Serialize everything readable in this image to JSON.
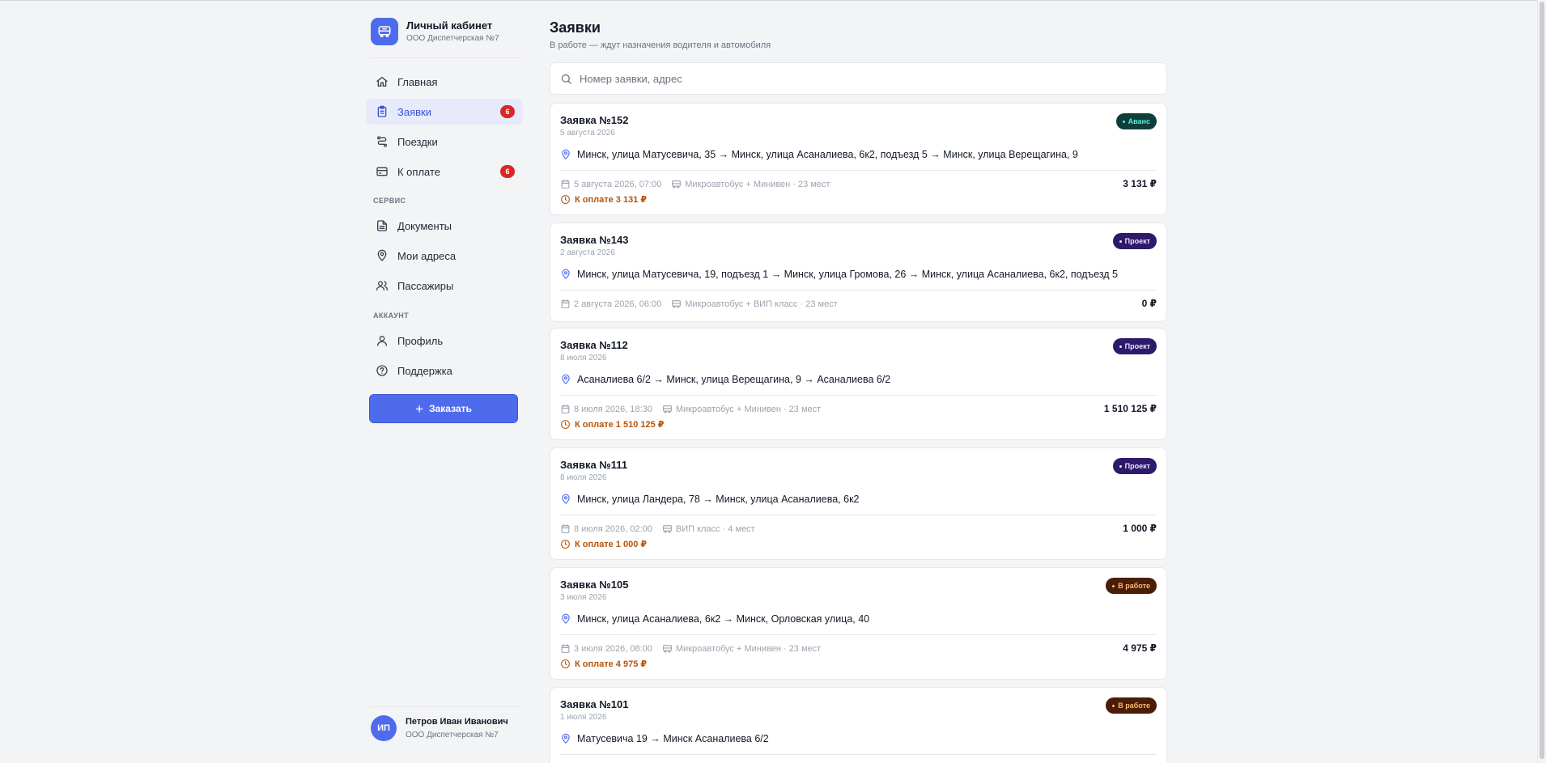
{
  "brand": {
    "title": "Личный кабинет",
    "subtitle": "ООО Диспетчерская №7"
  },
  "sidebar": {
    "items": [
      {
        "label": "Главная",
        "icon": "home-icon"
      },
      {
        "label": "Заявки",
        "icon": "clipboard-icon",
        "badge": "6",
        "active": true
      },
      {
        "label": "Поездки",
        "icon": "route-icon"
      },
      {
        "label": "К оплате",
        "icon": "card-icon",
        "badge": "6"
      }
    ],
    "service_label": "СЕРВИС",
    "service_items": [
      {
        "label": "Документы",
        "icon": "document-icon"
      },
      {
        "label": "Мои адреса",
        "icon": "pin-icon"
      },
      {
        "label": "Пассажиры",
        "icon": "users-icon"
      }
    ],
    "account_label": "АККАУНТ",
    "account_items": [
      {
        "label": "Профиль",
        "icon": "user-icon"
      },
      {
        "label": "Поддержка",
        "icon": "help-icon"
      }
    ],
    "order_button": "Заказать"
  },
  "user": {
    "initials": "ИП",
    "name": "Петров Иван Иванович",
    "org": "ООО Диспетчерская №7"
  },
  "main": {
    "title": "Заявки",
    "subtitle": "В работе — ждут назначения водителя и автомобиля",
    "search_placeholder": "Номер заявки, адрес"
  },
  "colors": {
    "accent": "#4f6bed",
    "badge": "#dc2626",
    "status_advance_bg": "#0f3d3a",
    "status_advance_fg": "#5eead4",
    "status_project_bg": "#2e1a6b",
    "status_project_fg": "#e9e4ff",
    "status_work_bg": "#4a1d07",
    "status_work_fg": "#fdba74",
    "pay_text": "#b45309"
  },
  "orders": [
    {
      "title": "Заявка №152",
      "date": "5 августа 2026",
      "status": "Аванс",
      "status_type": "advance",
      "route": "Минск, улица Матусевича, 35 → Минск, улица Асаналиева, 6к2, подъезд 5 → Минск, улица Верещагина, 9",
      "datetime": "5 августа 2026, 07:00",
      "vehicle": "Микроавтобус + Минивен · 23 мест",
      "price": "3 131 ₽",
      "payment": "К оплате 3 131 ₽"
    },
    {
      "title": "Заявка №143",
      "date": "2 августа 2026",
      "status": "Проект",
      "status_type": "project",
      "route": "Минск, улица Матусевича, 19, подъезд 1 → Минск, улица Громова, 26 → Минск, улица Асаналиева, 6к2, подъезд 5",
      "datetime": "2 августа 2026, 06:00",
      "vehicle": "Микроавтобус + ВИП класс · 23 мест",
      "price": "0 ₽",
      "payment": ""
    },
    {
      "title": "Заявка №112",
      "date": "8 июля 2026",
      "status": "Проект",
      "status_type": "project",
      "route": "Асаналиева 6/2 → Минск, улица Верещагина, 9 → Асаналиева 6/2",
      "datetime": "8 июля 2026, 18:30",
      "vehicle": "Микроавтобус + Минивен · 23 мест",
      "price": "1 510 125 ₽",
      "payment": "К оплате 1 510 125 ₽"
    },
    {
      "title": "Заявка №111",
      "date": "8 июля 2026",
      "status": "Проект",
      "status_type": "project",
      "route": "Минск, улица Ландера, 78 → Минск, улица Асаналиева, 6к2",
      "datetime": "8 июля 2026, 02:00",
      "vehicle": "ВИП класс · 4 мест",
      "price": "1 000 ₽",
      "payment": "К оплате 1 000 ₽"
    },
    {
      "title": "Заявка №105",
      "date": "3 июля 2026",
      "status": "В работе",
      "status_type": "work",
      "route": "Минск, улица Асаналиева, 6к2 → Минск, Орловская улица, 40",
      "datetime": "3 июля 2026, 08:00",
      "vehicle": "Микроавтобус + Минивен · 23 мест",
      "price": "4 975 ₽",
      "payment": "К оплате 4 975 ₽"
    },
    {
      "title": "Заявка №101",
      "date": "1 июля 2026",
      "status": "В работе",
      "status_type": "work",
      "route": "Матусевича 19 → Минск Асаналиева 6/2",
      "datetime": "",
      "vehicle": "",
      "price": "",
      "payment": ""
    }
  ]
}
